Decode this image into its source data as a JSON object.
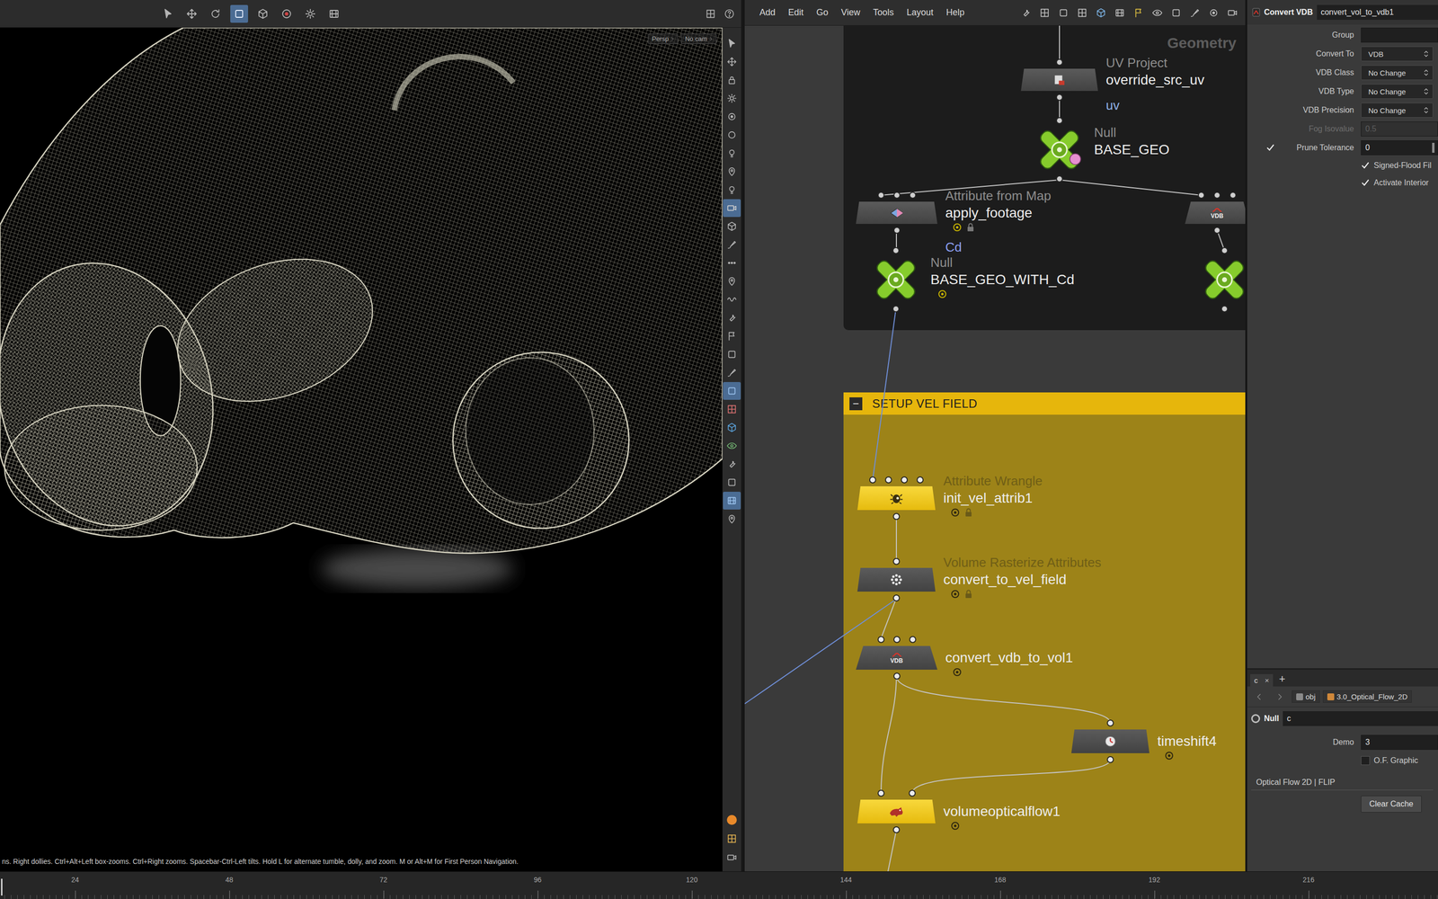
{
  "viewport": {
    "camera_menus": [
      "Persp",
      "No cam"
    ],
    "status": "ns. Right dollies. Ctrl+Alt+Left box-zooms. Ctrl+Right zooms. Spacebar-Ctrl-Left tilts. Hold L for alternate tumble, dolly, and zoom. M or Alt+M for First Person Navigation."
  },
  "network": {
    "menu": [
      "Add",
      "Edit",
      "Go",
      "View",
      "Tools",
      "Layout",
      "Help"
    ],
    "context": "Geometry",
    "nodes": [
      {
        "type": "UV Project",
        "name": "override_src_uv",
        "kind": "sop",
        "icon_text": "",
        "badge": false,
        "locked": false,
        "template": false
      },
      {
        "type": "Null",
        "name": "BASE_GEO",
        "kind": "null",
        "icon_text": "",
        "badge": false,
        "locked": false,
        "template": true
      },
      {
        "type": "Attribute from Map",
        "name": "apply_footage",
        "kind": "sop",
        "icon_text": "",
        "badge": true,
        "locked": true,
        "template": false
      },
      {
        "type": "",
        "name": "",
        "kind": "vdb",
        "icon_text": "VDB",
        "badge": false,
        "locked": false,
        "template": false
      },
      {
        "type": "Null",
        "name": "BASE_GEO_WITH_Cd",
        "kind": "null",
        "icon_text": "",
        "badge": true,
        "locked": false,
        "template": false
      },
      {
        "type": "",
        "name": "",
        "kind": "null",
        "icon_text": "",
        "badge": false,
        "locked": false,
        "template": false
      }
    ],
    "wire_labels": [
      {
        "text": "uv",
        "color": "#8fb0e6"
      },
      {
        "text": "Cd",
        "color": "#8c9ff0"
      }
    ],
    "network_box": {
      "collapse": "−",
      "title": "SETUP VEL FIELD",
      "nodes": [
        {
          "type": "Attribute Wrangle",
          "name": "init_vel_attrib1",
          "kind": "accent",
          "icon_text": "",
          "badge": true,
          "locked": true,
          "template": false
        },
        {
          "type": "Volume Rasterize Attributes",
          "name": "convert_to_vel_field",
          "kind": "sop",
          "icon_text": "",
          "badge": true,
          "locked": true,
          "template": false
        },
        {
          "type": "",
          "name": "convert_vdb_to_vol1",
          "kind": "vdb",
          "icon_text": "VDB",
          "badge": true,
          "locked": false,
          "template": false
        },
        {
          "type": "",
          "name": "timeshift4",
          "kind": "sop",
          "icon_text": "",
          "badge": true,
          "locked": false,
          "template": false
        },
        {
          "type": "",
          "name": "volumeopticalflow1",
          "kind": "accent",
          "icon_text": "",
          "badge": true,
          "locked": false,
          "template": false
        }
      ]
    }
  },
  "parameters": {
    "node_type": "Convert VDB",
    "node_name": "convert_vol_to_vdb1",
    "rows": [
      {
        "kind": "field",
        "label": "Group",
        "value": "",
        "disabled": false
      },
      {
        "kind": "menu",
        "label": "Convert To",
        "value": "VDB",
        "disabled": false
      },
      {
        "kind": "menu",
        "label": "VDB Class",
        "value": "No Change",
        "disabled": false
      },
      {
        "kind": "menu",
        "label": "VDB Type",
        "value": "No Change",
        "disabled": false
      },
      {
        "kind": "menu",
        "label": "VDB Precision",
        "value": "No Change",
        "disabled": false
      },
      {
        "kind": "field",
        "label": "Fog Isovalue",
        "value": "0.5",
        "disabled": true
      },
      {
        "kind": "toggle-field",
        "label": "Prune Tolerance",
        "value": "0",
        "checked": true,
        "disabled": false
      },
      {
        "kind": "toggle",
        "label": "Signed-Flood Fil",
        "checked": true,
        "disabled": false
      },
      {
        "kind": "toggle",
        "label": "Activate Interior",
        "checked": true,
        "disabled": false
      }
    ]
  },
  "lower_pane": {
    "tabs": [
      {
        "label": "c",
        "selected": true
      }
    ],
    "close": "×",
    "add": "+",
    "path": [
      "obj",
      "3.0_Optical_Flow_2D"
    ],
    "node_type": "Null",
    "node_name": "c",
    "rows": [
      {
        "kind": "field",
        "label": "Demo",
        "value": "3",
        "disabled": false
      },
      {
        "kind": "toggle",
        "label": "O.F. Graphic",
        "checked": false,
        "disabled": false
      }
    ],
    "section": "Optical Flow 2D | FLIP",
    "button": "Clear Cache"
  },
  "timeline": {
    "ticks": [
      "24",
      "48",
      "72",
      "96",
      "120",
      "144",
      "168",
      "192",
      "216"
    ]
  }
}
